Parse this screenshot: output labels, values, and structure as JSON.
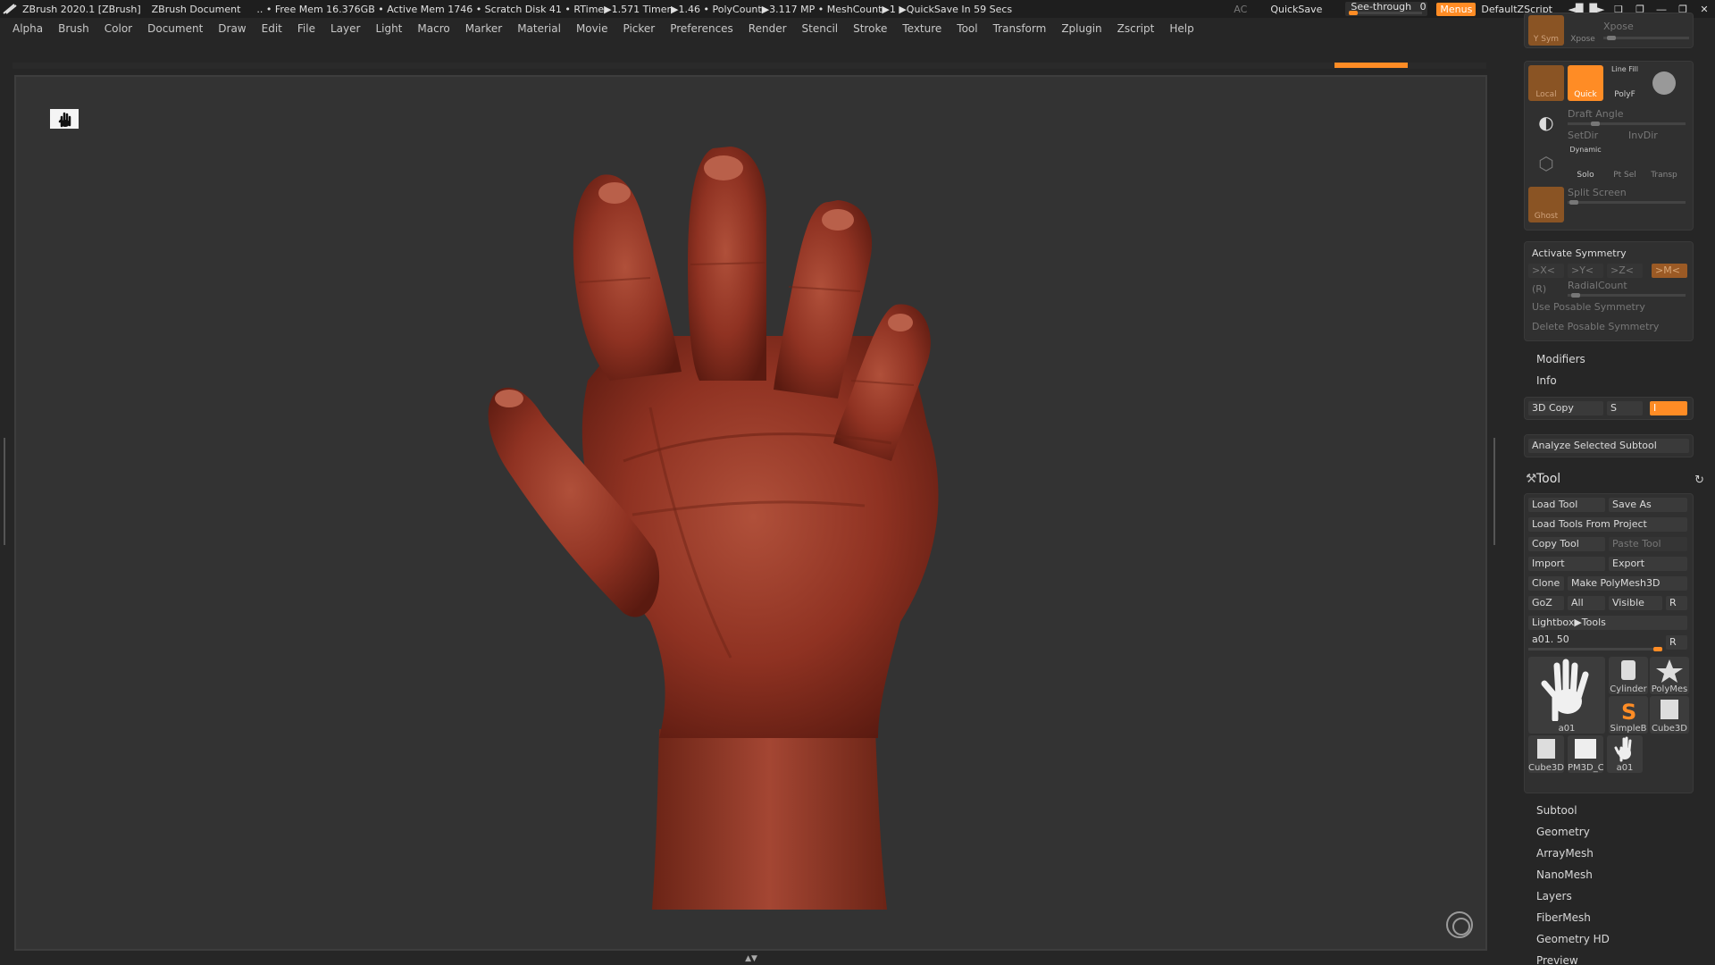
{
  "titlebar": {
    "app": "ZBrush 2020.1 [ZBrush]",
    "document": "ZBrush Document",
    "stats": ".. • Free Mem 16.376GB • Active Mem 1746 • Scratch Disk 41 • RTime▶1.571 Timer▶1.46 • PolyCount▶3.117 MP • MeshCount▶1 ▶QuickSave In 59 Secs",
    "ac": "AC",
    "quicksave": "QuickSave",
    "see_through_label": "See-through",
    "see_through_value": "0",
    "menus": "Menus",
    "default_zscript": "DefaultZScript"
  },
  "menu": [
    "Alpha",
    "Brush",
    "Color",
    "Document",
    "Draw",
    "Edit",
    "File",
    "Layer",
    "Light",
    "Macro",
    "Marker",
    "Material",
    "Movie",
    "Picker",
    "Preferences",
    "Render",
    "Stencil",
    "Stroke",
    "Texture",
    "Tool",
    "Transform",
    "Zplugin",
    "Zscript",
    "Help"
  ],
  "panel": {
    "top": {
      "ysym": "Y Sym",
      "xpose_btn": "Xpose",
      "xpose_label": "Xpose"
    },
    "draw": {
      "local": "Local",
      "quick": "Quick",
      "line_fill": "Line Fill",
      "polyf": "PolyF",
      "draft_angle": "Draft Angle",
      "setdir": "SetDir",
      "invdir": "InvDir",
      "dynamic": "Dynamic",
      "solo": "Solo",
      "pt_sel": "Pt Sel",
      "transp": "Transp",
      "ghost": "Ghost",
      "split_screen": "Split Screen"
    },
    "symmetry": {
      "activate": "Activate Symmetry",
      "x": ">X<",
      "y": ">Y<",
      "z": ">Z<",
      "m": ">M<",
      "r": "(R)",
      "radial_count": "RadialCount",
      "use_posable": "Use Posable Symmetry",
      "delete_posable": "Delete Posable Symmetry"
    },
    "modifiers": "Modifiers",
    "info": "Info",
    "copy3d": {
      "label": "3D Copy",
      "s": "S",
      "i": "I"
    },
    "analyze": "Analyze Selected Subtool",
    "tool": {
      "title": "Tool",
      "load_tool": "Load Tool",
      "save_as": "Save As",
      "load_from_project": "Load Tools From Project",
      "copy_tool": "Copy Tool",
      "paste_tool": "Paste Tool",
      "import": "Import",
      "export": "Export",
      "clone": "Clone",
      "make_polymesh": "Make PolyMesh3D",
      "goz": "GoZ",
      "all": "All",
      "visible": "Visible",
      "r": "R",
      "lightbox_tools": "Lightbox▶Tools",
      "current_tool": "a01. 50",
      "r2": "R",
      "thumbs": [
        "a01",
        "Cylinder",
        "PolyMes",
        "SimpleB",
        "Cube3D",
        "Cube3D",
        "PM3D_C",
        "a01"
      ]
    },
    "sections": [
      "Subtool",
      "Geometry",
      "ArrayMesh",
      "NanoMesh",
      "Layers",
      "FiberMesh",
      "Geometry HD",
      "Preview"
    ]
  },
  "colors": {
    "accent": "#ff8c25",
    "skin": "#8f3222",
    "viewport": "#333333"
  },
  "icons": [
    "zbrush-logo-icon",
    "hand-icon",
    "navigation-circle-icon",
    "tool-brush-icon",
    "refresh-icon"
  ]
}
